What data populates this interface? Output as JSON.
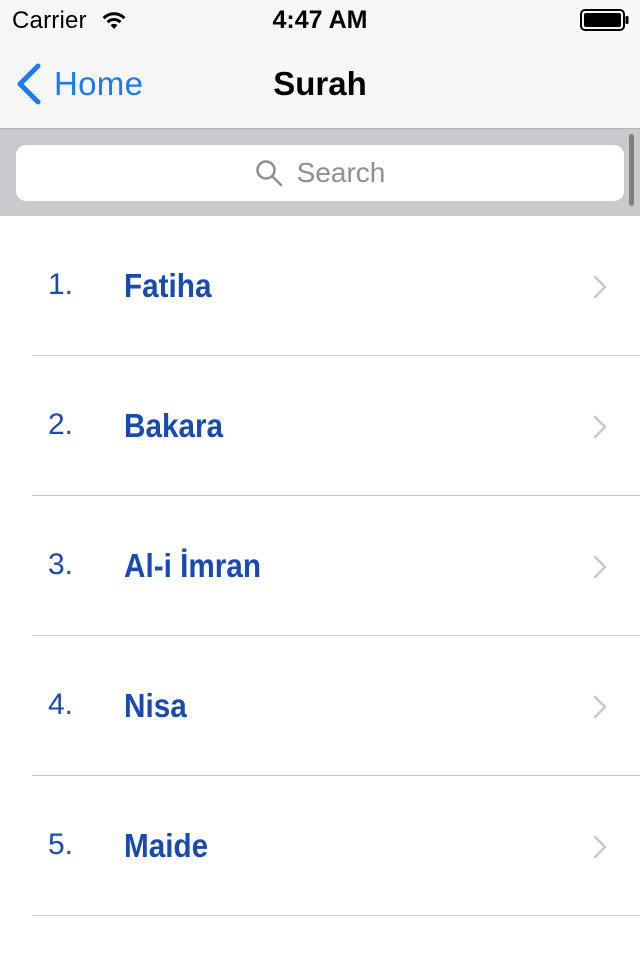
{
  "status_bar": {
    "carrier": "Carrier",
    "time": "4:47 AM",
    "icons": [
      "wifi-icon",
      "battery-icon"
    ]
  },
  "nav_bar": {
    "back_label": "Home",
    "title": "Surah"
  },
  "search": {
    "placeholder": "Search"
  },
  "surahs": [
    {
      "number": "1.",
      "name": "Fatiha"
    },
    {
      "number": "2.",
      "name": "Bakara"
    },
    {
      "number": "3.",
      "name": "Al-i İmran"
    },
    {
      "number": "4.",
      "name": "Nisa"
    },
    {
      "number": "5.",
      "name": "Maide"
    }
  ],
  "colors": {
    "tint": "#1a7bf2",
    "list_text": "#1a49b0",
    "bar_background": "#f7f7f7",
    "search_background": "#c9c9ce",
    "separator": "#c8c7cc"
  }
}
